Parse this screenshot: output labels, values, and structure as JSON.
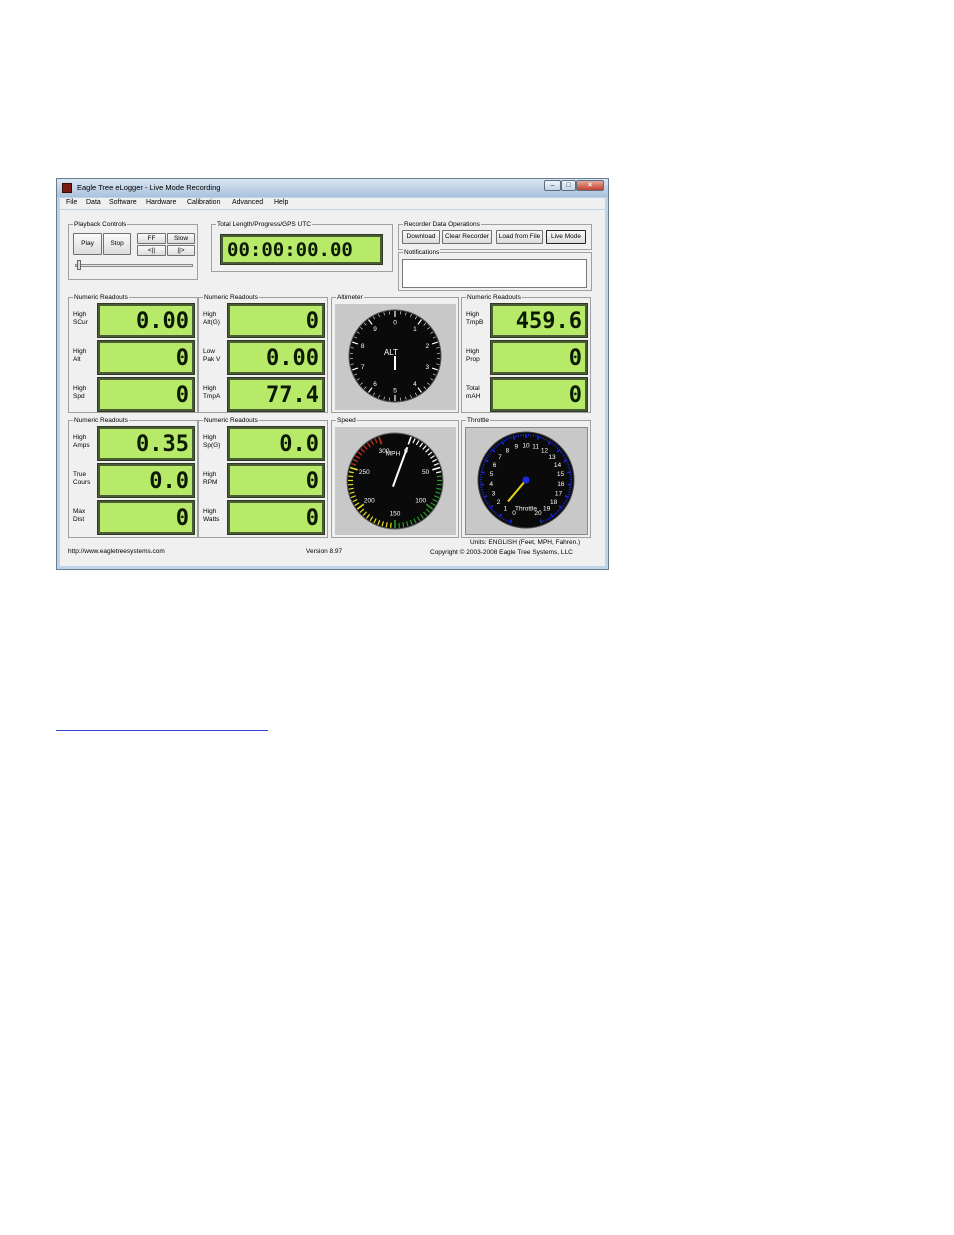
{
  "window": {
    "title": "Eagle Tree eLogger - Live Mode Recording",
    "caption_buttons": [
      "minimize-icon",
      "maximize-icon",
      "close-icon"
    ]
  },
  "menu": [
    "File",
    "Data",
    "Software",
    "Hardware",
    "Calibration",
    "Advanced",
    "Help"
  ],
  "playback": {
    "label": "Playback Controls",
    "play": "Play",
    "stop": "Stop",
    "ff": "FF",
    "slow": "Slow",
    "back": "<||",
    "forward": "||>"
  },
  "total_length": {
    "label": "Total Length/Progress/GPS UTC",
    "value": "00:00:00.00"
  },
  "recorder": {
    "label": "Recorder Data Operations",
    "download": "Download",
    "clear": "Clear Recorder",
    "load": "Load from File",
    "live": "Live Mode",
    "notifications_label": "Notifications"
  },
  "readouts": [
    {
      "label": "Numeric Readouts",
      "rows": [
        {
          "name": "High\nSCur",
          "value": "0.00"
        },
        {
          "name": "High\nAlt",
          "value": "0"
        },
        {
          "name": "High\nSpd",
          "value": "0"
        }
      ]
    },
    {
      "label": "Numeric Readouts",
      "rows": [
        {
          "name": "High\nAlt(G)",
          "value": "0"
        },
        {
          "name": "Low\nPak V",
          "value": "0.00"
        },
        {
          "name": "High\nTmpA",
          "value": "77.4"
        }
      ]
    },
    {
      "label": "Numeric Readouts",
      "rows": [
        {
          "name": "High\nTmpB",
          "value": "459.6"
        },
        {
          "name": "High\nProp",
          "value": "0"
        },
        {
          "name": "Total\nmAH",
          "value": "0"
        }
      ]
    },
    {
      "label": "Numeric Readouts",
      "rows": [
        {
          "name": "High\nAmps",
          "value": "0.35"
        },
        {
          "name": "True\nCours",
          "value": "0.0"
        },
        {
          "name": "Max\nDist",
          "value": "0"
        }
      ]
    },
    {
      "label": "Numeric Readouts",
      "rows": [
        {
          "name": "High\nSp(G)",
          "value": "0.0"
        },
        {
          "name": "High\nRPM",
          "value": "0"
        },
        {
          "name": "High\nWatts",
          "value": "0"
        }
      ]
    }
  ],
  "altimeter": {
    "label": "Altimeter",
    "center_label": "ALT",
    "ticks": [
      "0",
      "1",
      "2",
      "3",
      "4",
      "5",
      "6",
      "7",
      "8",
      "9"
    ],
    "value": 0
  },
  "speed": {
    "label": "Speed",
    "unit": "MPH",
    "ticks": [
      "0",
      "50",
      "100",
      "150",
      "200",
      "250",
      "300"
    ],
    "value": 0,
    "colors": {
      "green": "#2a9a2a",
      "yellow": "#e6e020",
      "red": "#d03020"
    }
  },
  "throttle": {
    "label": "Throttle",
    "center_label": "Throttle",
    "ticks": [
      "0",
      "1",
      "2",
      "3",
      "4",
      "5",
      "6",
      "7",
      "8",
      "9",
      "10",
      "11",
      "12",
      "13",
      "14",
      "15",
      "16",
      "17",
      "18",
      "19",
      "20"
    ],
    "value": 0,
    "scale_color": "#1a2ae0",
    "needle_color": "#e8d41c"
  },
  "footer": {
    "url": "http://www.eagletreesystems.com",
    "version": "Version 8.97",
    "units": "Units: ENGLISH (Feet, MPH, Fahren.)",
    "copyright": "Copyright © 2003-2008 Eagle Tree Systems, LLC"
  }
}
